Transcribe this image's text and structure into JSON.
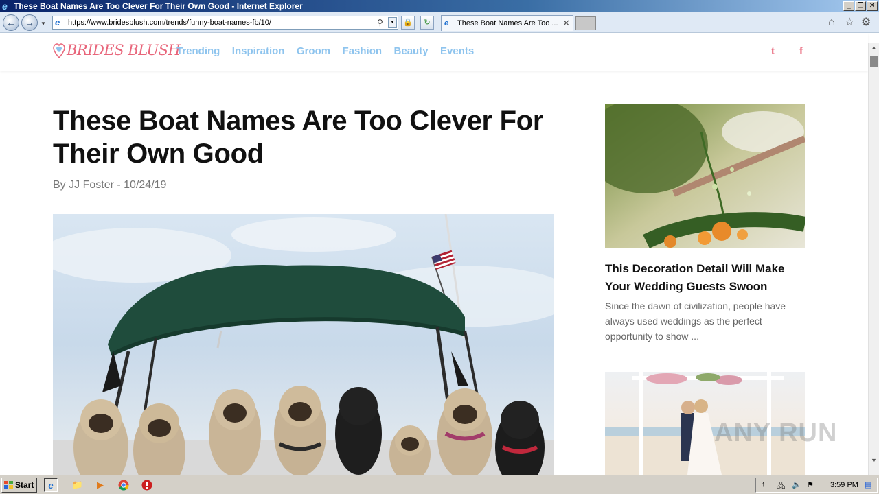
{
  "window": {
    "title": "These Boat Names Are Too Clever For Their Own Good - Internet Explorer",
    "minimize": "_",
    "restore": "❐",
    "close": "✕"
  },
  "browser": {
    "url": "https://www.bridesblush.com/trends/funny-boat-names-fb/10/",
    "tab_title": "These Boat Names Are Too ...",
    "tab_close": "✕",
    "back_icon": "arrow-left",
    "forward_icon": "arrow-right"
  },
  "site": {
    "logo": "BRIDES BLUSH",
    "nav": [
      "Trending",
      "Inspiration",
      "Groom",
      "Fashion",
      "Beauty",
      "Events"
    ],
    "twitter": "t",
    "facebook": "f",
    "brand_color": "#e8657a",
    "nav_color": "#8ec4ee"
  },
  "article": {
    "title": "These Boat Names Are Too Clever For Their Own Good",
    "byline_prefix": "By",
    "author": "JJ Foster",
    "separator": "-",
    "date": "10/24/19"
  },
  "sidebar": {
    "card1": {
      "title": "This Decoration Detail Will Make Your Wedding Guests Swoon",
      "excerpt": "Since the dawn of civilization, people have always used weddings as the perfect opportunity to show ..."
    }
  },
  "watermark": "ANY RUN",
  "taskbar": {
    "start": "Start",
    "clock": "3:59 PM"
  }
}
